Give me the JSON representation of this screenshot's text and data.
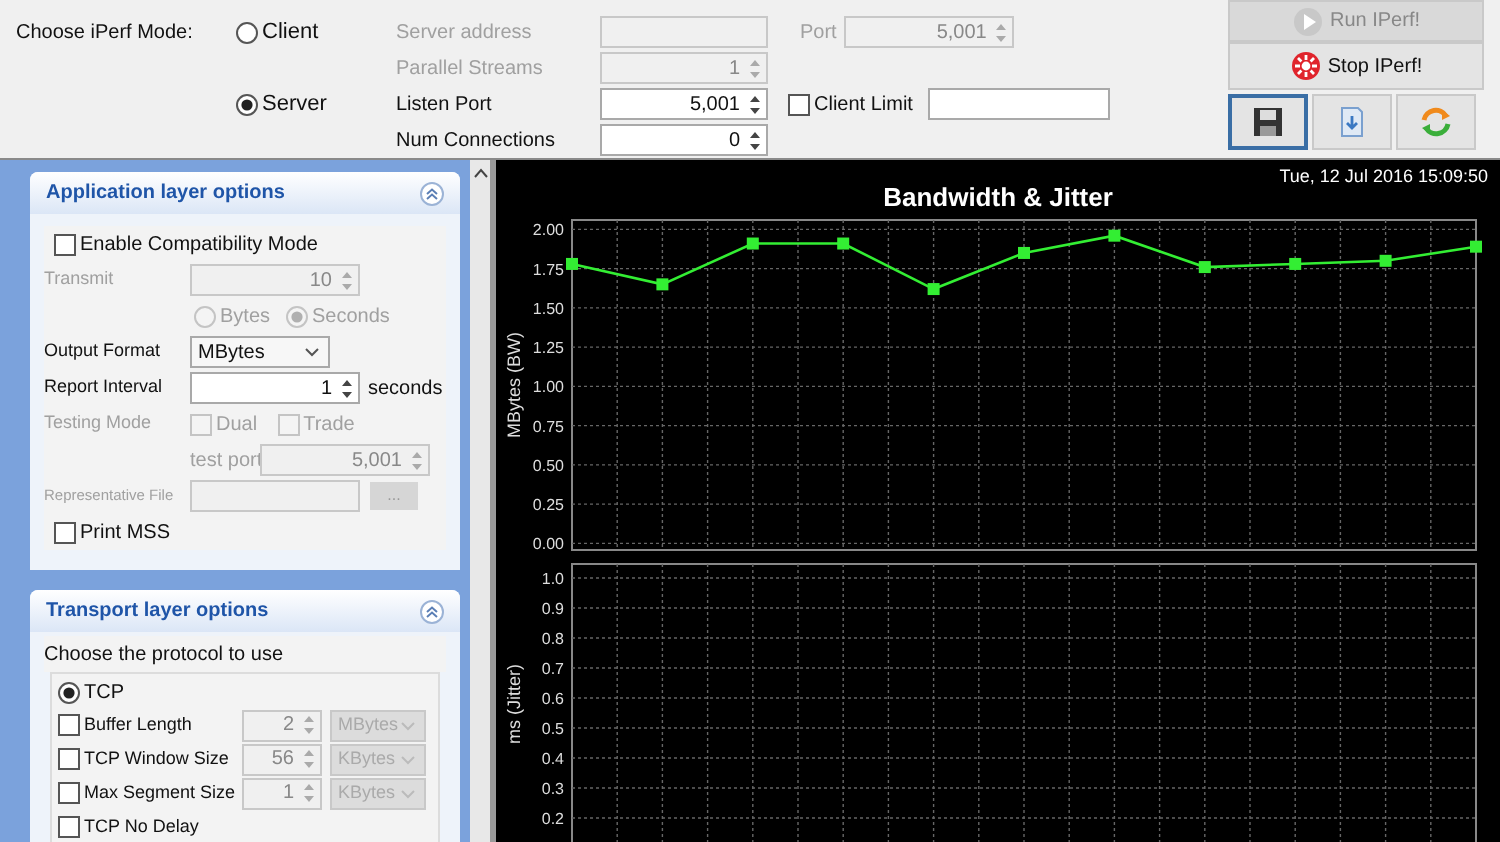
{
  "mode": {
    "label": "Choose iPerf Mode:",
    "options": [
      {
        "label": "Client",
        "selected": false
      },
      {
        "label": "Server",
        "selected": true
      }
    ]
  },
  "client_fields": [
    {
      "label": "Server address",
      "kind": "text",
      "disabled": true
    },
    {
      "label": "Parallel Streams",
      "kind": "spinner",
      "value": "1",
      "disabled": true
    }
  ],
  "port": {
    "label": "Port",
    "value": "5,001",
    "disabled": true
  },
  "server_fields": [
    {
      "label": "Listen Port",
      "kind": "spinner",
      "value": "5,001",
      "disabled": false
    },
    {
      "label": "Num Connections",
      "kind": "spinner",
      "value": "0",
      "disabled": false
    }
  ],
  "client_limit": {
    "label": "Client Limit",
    "checked": false
  },
  "buttons": [
    {
      "label": "Run IPerf!",
      "kind": "run",
      "disabled": true
    },
    {
      "label": "Stop IPerf!",
      "kind": "stop",
      "disabled": false
    }
  ],
  "icon_buttons": [
    {
      "kind": "save",
      "focused": true
    },
    {
      "kind": "import",
      "focused": false
    },
    {
      "kind": "refresh",
      "focused": false
    }
  ],
  "application_panel": {
    "title": "Application layer options",
    "rows": [
      {
        "kind": "checkbox",
        "label": "Enable Compatibility Mode",
        "checked": false,
        "disabled": false
      },
      {
        "kind": "spinner",
        "label": "Transmit",
        "value": "10",
        "disabled": true
      },
      {
        "kind": "radios",
        "disabled": true,
        "options": [
          {
            "label": "Bytes",
            "selected": false
          },
          {
            "label": "Seconds",
            "selected": true
          }
        ]
      },
      {
        "kind": "dropdown",
        "label": "Output Format",
        "value": "MBytes",
        "disabled": false
      },
      {
        "kind": "spinner",
        "label": "Report Interval",
        "value": "1",
        "unit": "seconds",
        "disabled": false
      },
      {
        "kind": "checks",
        "label": "Testing Mode",
        "disabled": true,
        "options": [
          {
            "label": "Dual",
            "checked": false
          },
          {
            "label": "Trade",
            "checked": false
          }
        ]
      },
      {
        "kind": "subspinner",
        "label": "test port",
        "value": "5,001",
        "disabled": true
      },
      {
        "kind": "file",
        "label": "Representative File",
        "button": "...",
        "disabled": true
      },
      {
        "kind": "checkbox",
        "label": "Print MSS",
        "checked": false,
        "disabled": false
      }
    ]
  },
  "transport_panel": {
    "title": "Transport layer options",
    "prompt": "Choose the protocol to use",
    "protocol": {
      "label": "TCP",
      "selected": true
    },
    "options": [
      {
        "label": "Buffer Length",
        "checked": false,
        "value": "2",
        "unit": "MBytes"
      },
      {
        "label": "TCP Window Size",
        "checked": false,
        "value": "56",
        "unit": "KBytes"
      },
      {
        "label": "Max Segment Size",
        "checked": false,
        "value": "1",
        "unit": "KBytes"
      },
      {
        "label": "TCP No Delay",
        "checked": false
      }
    ]
  },
  "chart_panel": {
    "timestamp": "Tue, 12 Jul 2016 15:09:50",
    "title": "Bandwidth & Jitter",
    "charts": [
      {
        "chart_data": {
          "type": "line",
          "grid": true,
          "categories": [
            null,
            null,
            null,
            null,
            null,
            null,
            null,
            null,
            null,
            null,
            null
          ],
          "ylabel": "MBytes (BW)",
          "ylim": [
            0,
            2
          ],
          "yticks": [
            {
              "value": 0,
              "label": "0.00"
            },
            {
              "value": 0.25,
              "label": "0.25"
            },
            {
              "value": 0.5,
              "label": "0.50"
            },
            {
              "value": 0.75,
              "label": "0.75"
            },
            {
              "value": 1,
              "label": "1.00"
            },
            {
              "value": 1.25,
              "label": "1.25"
            },
            {
              "value": 1.5,
              "label": "1.50"
            },
            {
              "value": 1.75,
              "label": "1.75"
            },
            {
              "value": 2,
              "label": "2.00"
            }
          ],
          "series": [
            {
              "color": "#33ee33",
              "marker": "square",
              "values": [
                1.78,
                1.65,
                1.91,
                1.91,
                1.62,
                1.85,
                1.96,
                1.76,
                1.78,
                1.8,
                1.89
              ]
            }
          ]
        }
      },
      {
        "chart_data": {
          "type": "line",
          "grid": true,
          "categories": [
            null,
            null,
            null,
            null,
            null,
            null,
            null,
            null,
            null,
            null,
            null
          ],
          "ylabel": "ms (Jitter)",
          "ylim": [
            0.2,
            1
          ],
          "yticks": [
            {
              "value": 0.2,
              "label": "0.2"
            },
            {
              "value": 0.3,
              "label": "0.3"
            },
            {
              "value": 0.4,
              "label": "0.4"
            },
            {
              "value": 0.5,
              "label": "0.5"
            },
            {
              "value": 0.6,
              "label": "0.6"
            },
            {
              "value": 0.7,
              "label": "0.7"
            },
            {
              "value": 0.8,
              "label": "0.8"
            },
            {
              "value": 0.9,
              "label": "0.9"
            },
            {
              "value": 1,
              "label": "1.0"
            }
          ]
        }
      }
    ]
  }
}
